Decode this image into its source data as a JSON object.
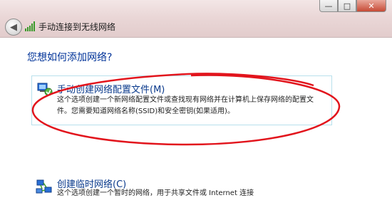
{
  "window": {
    "title": "手动连接到无线网络",
    "controls": {
      "minimize": "—",
      "maximize": "□",
      "close": "✕"
    }
  },
  "prompt": "您想如何添加网络?",
  "options": [
    {
      "title": "手动创建网络配置文件(M)",
      "description_line1": "这个选项创建一个新网络配置文件或查找现有网络并在计算机上保存网络的配置文",
      "description_line2": "件。您需要知道网络名称(SSID)和安全密钥(如果适用)。",
      "icon": "network-profile-icon",
      "selected": true
    },
    {
      "title": "创建临时网络(C)",
      "description_line1": "这个选项创建一个暂时的网络，用于共享文件或 Internet 连接",
      "icon": "adhoc-network-icon",
      "selected": false
    }
  ],
  "annotation": {
    "shape": "ellipse",
    "color": "#e2141c"
  }
}
